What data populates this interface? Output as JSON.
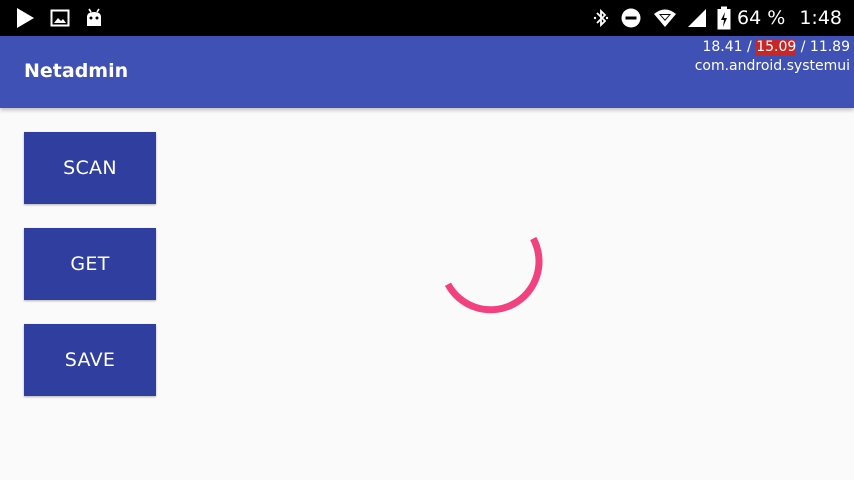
{
  "status_bar": {
    "icons_left": [
      "play-store-icon",
      "image-icon",
      "android-debug-icon"
    ],
    "icons_right": [
      "bluetooth-icon",
      "do-not-disturb-icon",
      "wifi-icon",
      "cell-signal-icon",
      "battery-charging-icon"
    ],
    "battery_percent": "64 %",
    "time": "1:48"
  },
  "app_bar": {
    "title": "Netadmin"
  },
  "overlay": {
    "v1": "18.41",
    "sep1": " / ",
    "v2": "15.09",
    "sep2": " / ",
    "v3": "11.89",
    "process": "com.android.systemui"
  },
  "buttons": {
    "scan": "SCAN",
    "get": "GET",
    "save": "SAVE"
  },
  "colors": {
    "app_bar": "#3f51b5",
    "button": "#303f9f",
    "spinner": "#f2417e",
    "background": "#fafafa"
  }
}
